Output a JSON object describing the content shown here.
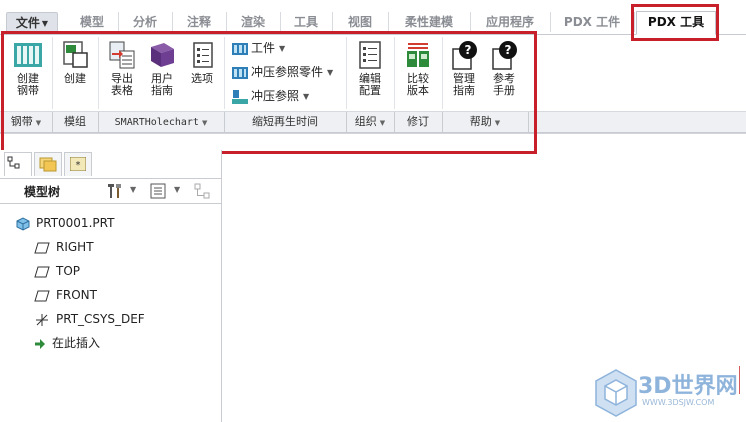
{
  "tabs": {
    "file": "文件",
    "items": [
      "模型",
      "分析",
      "注释",
      "渲染",
      "工具",
      "视图",
      "柔性建模",
      "应用程序",
      "PDX 工件"
    ],
    "active": "PDX 工具"
  },
  "ribbon": {
    "create_rebar": "创建\n钢带",
    "create": "创建",
    "export_table": "导出\n表格",
    "user_guide": "用户\n指南",
    "options": "选项",
    "workpiece": "工件",
    "stamping_part": "冲压参照零件",
    "stamping_ref": "冲压参照",
    "edit_config": "编辑\n配置",
    "compare_version": "比较\n版本",
    "manage_guide": "管理\n指南",
    "ref_manual": "参考\n手册"
  },
  "groups": {
    "rebar": "钢带",
    "module": "模组",
    "smart": "SMARTHolechart",
    "shorten": "缩短再生时间",
    "organize": "组织",
    "revise": "修订",
    "help": "帮助"
  },
  "model_tree": {
    "title": "模型树",
    "nodes": [
      "PRT0001.PRT",
      "RIGHT",
      "TOP",
      "FRONT",
      "PRT_CSYS_DEF",
      "在此插入"
    ]
  },
  "watermark": {
    "text": "3D世界网",
    "sub": "WWW.3DSJW.COM"
  },
  "colors": {
    "highlight_red": "#c8202a",
    "ribbon_bg": "#ffffff",
    "group_bar_bg": "#eef0f3"
  }
}
